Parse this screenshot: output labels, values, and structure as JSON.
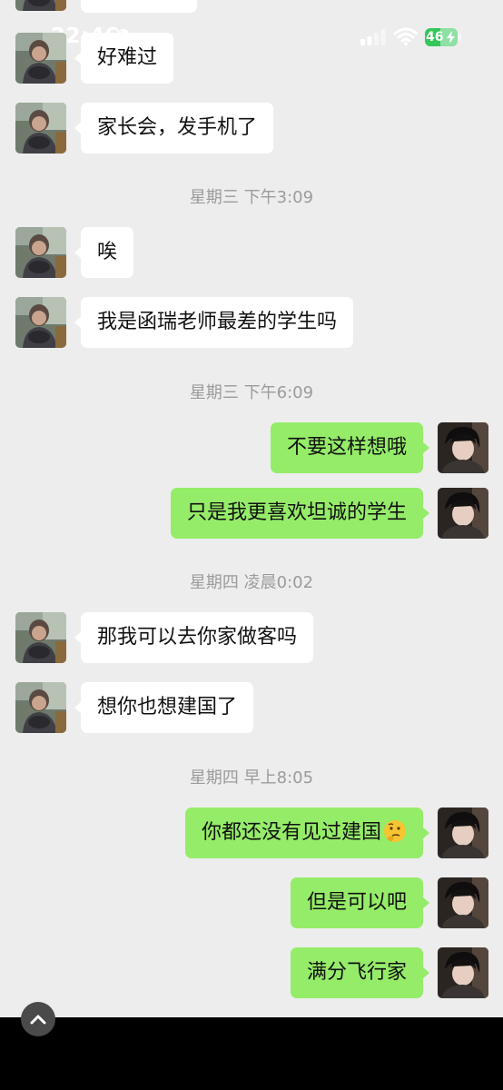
{
  "status_bar": {
    "time": "22:46",
    "network": "4G",
    "battery_level": "46",
    "battery_fraction": 0.46,
    "icons": [
      "bell-slash-icon",
      "signal-icon",
      "wifi-icon",
      "battery-icon",
      "charging-bolt-icon"
    ]
  },
  "colors": {
    "background": "#ededed",
    "incoming_bubble": "#ffffff",
    "outgoing_bubble": "#95ec69",
    "timestamp_text": "#9b9b9b",
    "battery": "#34c759"
  },
  "messages": [
    {
      "side": "in",
      "text": "好难过"
    },
    {
      "side": "in",
      "text": "家长会，发手机了"
    },
    {
      "timestamp": "星期三 下午3:09"
    },
    {
      "side": "in",
      "text": "唉"
    },
    {
      "side": "in",
      "text": "我是函瑞老师最差的学生吗"
    },
    {
      "timestamp": "星期三 下午6:09"
    },
    {
      "side": "out",
      "text": "不要这样想哦"
    },
    {
      "side": "out",
      "text": "只是我更喜欢坦诚的学生"
    },
    {
      "timestamp": "星期四 凌晨0:02"
    },
    {
      "side": "in",
      "text": "那我可以去你家做客吗"
    },
    {
      "side": "in",
      "text": "想你也想建国了"
    },
    {
      "timestamp": "星期四 早上8:05"
    },
    {
      "side": "out",
      "text": "你都还没有见过建国",
      "emoji": "thinking-face-icon"
    },
    {
      "side": "out",
      "text": "但是可以吧"
    },
    {
      "side": "out",
      "text": "满分飞行家"
    }
  ],
  "scroll_button": {
    "icon": "chevron-up-icon"
  }
}
